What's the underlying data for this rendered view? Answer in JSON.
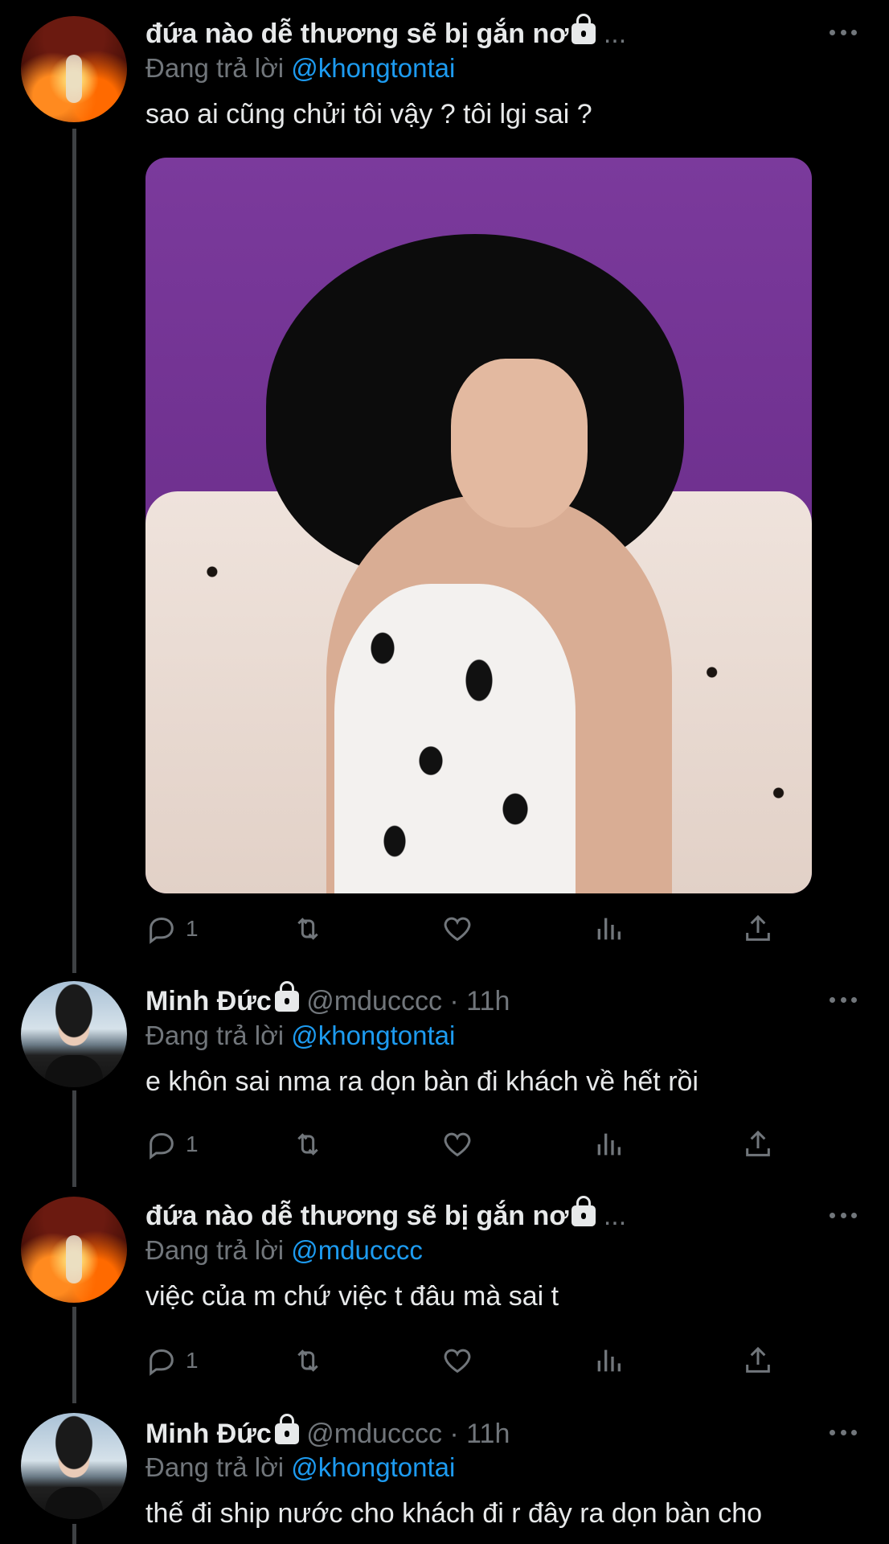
{
  "tweets": [
    {
      "display_name": "đứa nào dễ thương sẽ bị gắn nơ",
      "name_suffix": "...",
      "reply_prefix": "Đang trả lời",
      "reply_to": "@khongtontai",
      "text": "sao ai cũng chửi tôi vậy ? tôi lgi sai ?",
      "reply_count": "1",
      "avatar": "fire-skeleton-avatar",
      "has_media": true
    },
    {
      "display_name": "Minh Đức",
      "handle": "@mducccc",
      "time": "· 11h",
      "reply_prefix": "Đang trả lời",
      "reply_to": "@khongtontai",
      "text": "e khôn sai nma ra dọn bàn đi khách về hết rồi",
      "reply_count": "1",
      "avatar": "person-avatar"
    },
    {
      "display_name": "đứa nào dễ thương sẽ bị gắn nơ",
      "name_suffix": "...",
      "reply_prefix": "Đang trả lời",
      "reply_to": "@mducccc",
      "text": "việc của m chứ việc t đâu mà sai t",
      "reply_count": "1",
      "avatar": "fire-skeleton-avatar"
    },
    {
      "display_name": "Minh Đức",
      "handle": "@mducccc",
      "time": "· 11h",
      "reply_prefix": "Đang trả lời",
      "reply_to": "@khongtontai",
      "text": "thế đi ship nước cho khách đi r đây ra dọn bàn cho",
      "avatar": "person-avatar"
    }
  ],
  "icons": {
    "reply": "reply-icon",
    "retweet": "retweet-icon",
    "like": "heart-icon",
    "views": "analytics-icon",
    "share": "share-icon",
    "more": "more-options-icon",
    "locked": "lock-icon"
  },
  "colors": {
    "background": "#000000",
    "text": "#e7e9ea",
    "muted": "#71767b",
    "link": "#1d9bf0",
    "thread_line": "#3e4144"
  }
}
